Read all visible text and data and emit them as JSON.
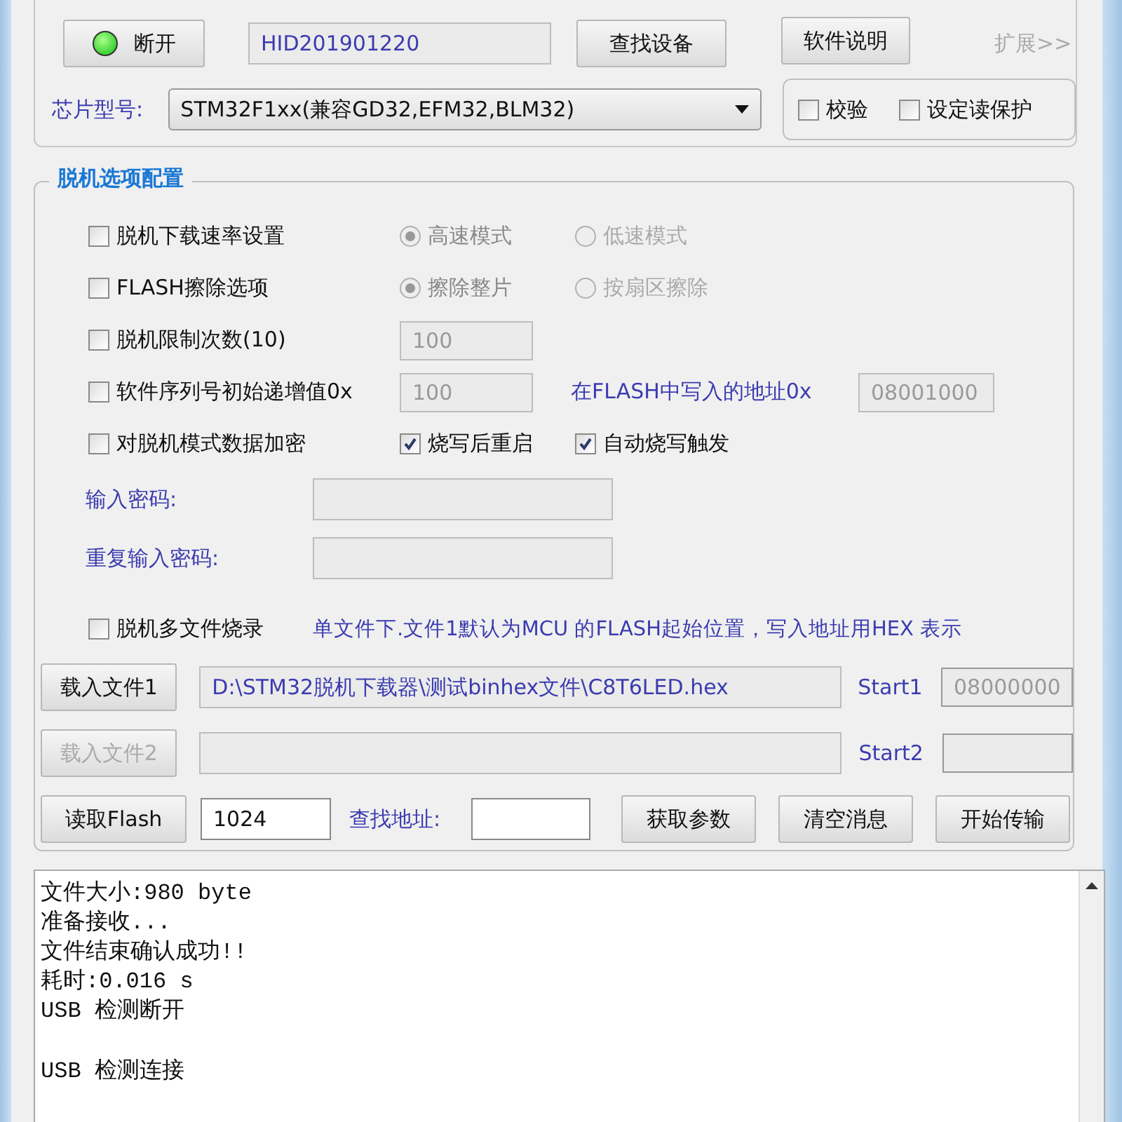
{
  "device": {
    "connected": true,
    "connect_button": "断开",
    "id_field": "HID201901220",
    "find_button": "查找设备",
    "help_button": "软件说明",
    "expand_link": {
      "label": "扩展>>",
      "disabled": true
    }
  },
  "chip": {
    "label": "芯片型号:",
    "value": "STM32F1xx(兼容GD32,EFM32,BLM32)"
  },
  "top_checks": [
    {
      "label": "校验",
      "checked": false
    },
    {
      "label": "设定读保护",
      "checked": false
    }
  ],
  "offline": {
    "title": "脱机选项配置",
    "options": [
      {
        "kind": "radio_row",
        "label": "脱机下载速率设置",
        "checked": false,
        "radios": [
          {
            "label": "高速模式",
            "selected": true
          },
          {
            "label": "低速模式",
            "selected": false
          }
        ]
      },
      {
        "kind": "radio_row",
        "label": "FLASH擦除选项",
        "checked": false,
        "radios": [
          {
            "label": "擦除整片",
            "selected": true
          },
          {
            "label": "按扇区擦除",
            "selected": false
          }
        ]
      },
      {
        "kind": "field_row",
        "label": "脱机限制次数(10)",
        "checked": false,
        "value": "100"
      },
      {
        "kind": "field_row",
        "label": "软件序列号初始递增值0x",
        "checked": false,
        "value": "100",
        "extra_label": "在FLASH中写入的地址0x",
        "extra_value": "08001000"
      },
      {
        "kind": "check_row",
        "label": "对脱机模式数据加密",
        "checked": false,
        "checks": [
          {
            "label": "烧写后重启",
            "checked": true
          },
          {
            "label": "自动烧写触发",
            "checked": true
          }
        ]
      }
    ],
    "passwords": [
      {
        "label": "输入密码:"
      },
      {
        "label": "重复输入密码:"
      }
    ],
    "multi_file": {
      "label": "脱机多文件烧录",
      "checked": false,
      "note": "单文件下.文件1默认为MCU 的FLASH起始位置，写入地址用HEX 表示"
    },
    "files": [
      {
        "button": "载入文件1",
        "disabled": false,
        "path": "D:\\STM32脱机下载器\\测试binhex文件\\C8T6LED.hex",
        "start_label": "Start1",
        "start_value": "08000000"
      },
      {
        "button": "载入文件2",
        "disabled": true,
        "start_label": "Start2"
      }
    ],
    "bottom": {
      "read_button": "读取Flash",
      "size_value": "1024",
      "find_label": "查找地址:",
      "buttons": [
        "获取参数",
        "清空消息",
        "开始传输"
      ]
    }
  },
  "log": {
    "blocks": [
      [
        "文件大小:980 byte",
        "准备接收...",
        "文件结束确认成功!!",
        "耗时:0.016 s",
        "USB 检测断开"
      ],
      [
        "USB 检测连接"
      ]
    ]
  }
}
